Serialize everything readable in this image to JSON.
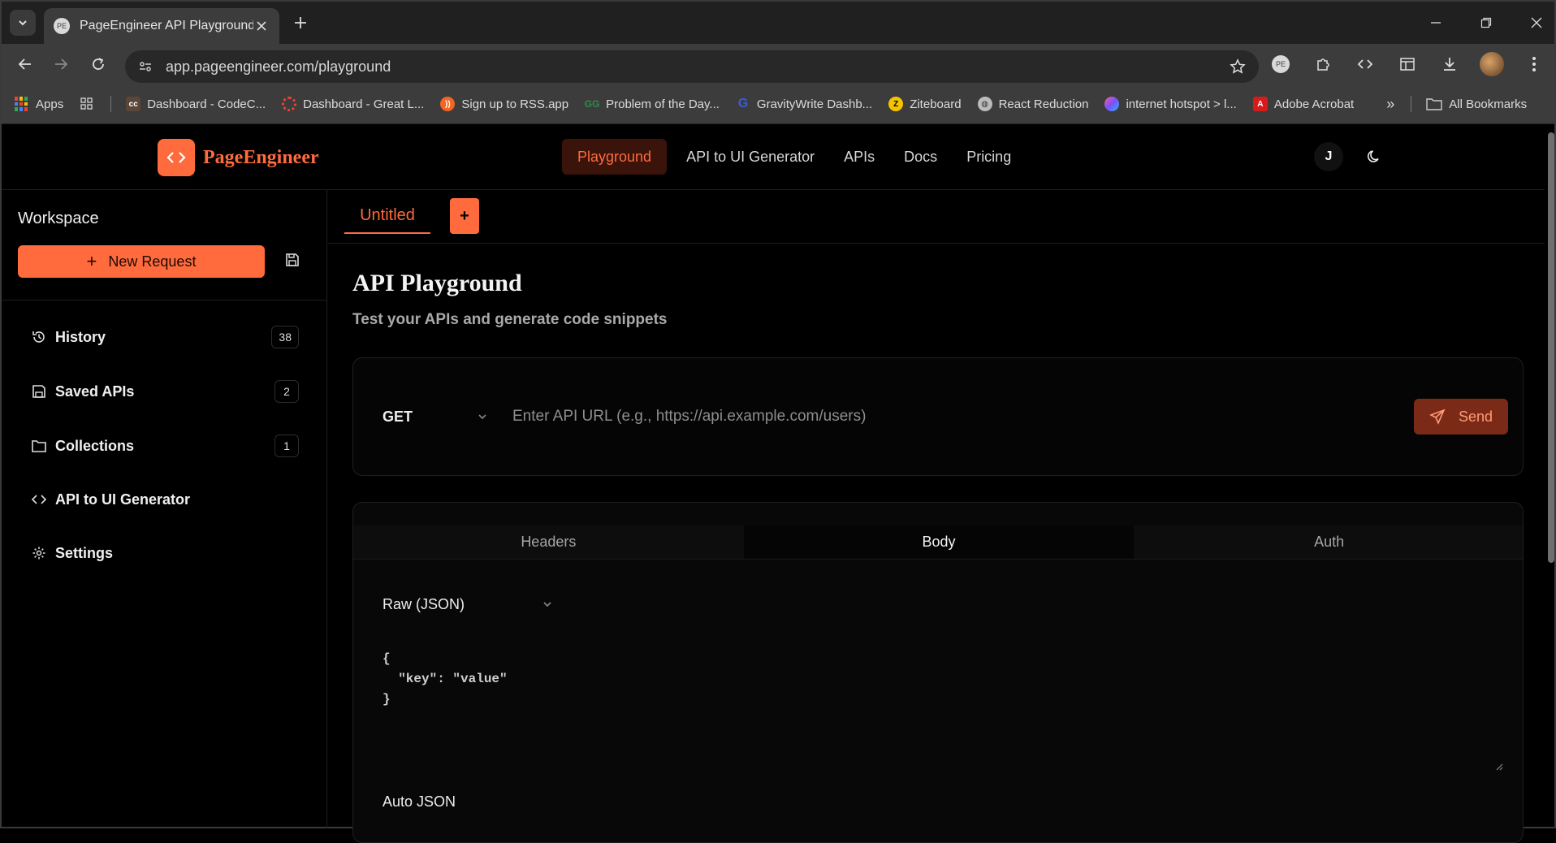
{
  "browser": {
    "tab_title": "PageEngineer API Playground",
    "tab_favicon": "PE",
    "url": "app.pageengineer.com/playground",
    "bookmarks": [
      {
        "label": "Apps",
        "icon": "apps-grid-icon",
        "color": "#4285f4"
      },
      {
        "label": "Dashboard - CodeC...",
        "icon": "codechef-icon",
        "color": "#5b4638"
      },
      {
        "label": "Dashboard - Great L...",
        "icon": "greatlearning-icon",
        "color": "#e94235"
      },
      {
        "label": "Sign up to RSS.app",
        "icon": "rss-icon",
        "color": "#f26522"
      },
      {
        "label": "Problem of the Day...",
        "icon": "gfg-icon",
        "color": "#2f8d46"
      },
      {
        "label": "GravityWrite Dashb...",
        "icon": "gravitywrite-icon",
        "color": "#3b5bdb"
      },
      {
        "label": "Ziteboard",
        "icon": "ziteboard-icon",
        "color": "#f5c400"
      },
      {
        "label": "React Reduction",
        "icon": "globe-icon",
        "color": "#aaaaaa"
      },
      {
        "label": "internet hotspot > l...",
        "icon": "hotspot-icon",
        "color": "#8e6cef"
      },
      {
        "label": "Adobe Acrobat",
        "icon": "acrobat-icon",
        "color": "#d71b1b"
      }
    ],
    "all_bookmarks": "All Bookmarks"
  },
  "app": {
    "brand": "PageEngineer",
    "nav": [
      "Playground",
      "API to UI Generator",
      "APIs",
      "Docs",
      "Pricing"
    ],
    "user_initial": "J",
    "accent": "#ff6b3d"
  },
  "sidebar": {
    "title": "Workspace",
    "new_request": "New Request",
    "items": [
      {
        "label": "History",
        "count": "38",
        "icon": "history-icon"
      },
      {
        "label": "Saved APIs",
        "count": "2",
        "icon": "save-icon"
      },
      {
        "label": "Collections",
        "count": "1",
        "icon": "folder-icon"
      },
      {
        "label": "API to UI Generator",
        "count": null,
        "icon": "code-icon"
      },
      {
        "label": "Settings",
        "count": null,
        "icon": "gear-icon"
      }
    ]
  },
  "main": {
    "tab": "Untitled",
    "add_tab": "+",
    "title": "API Playground",
    "subtitle": "Test your APIs and generate code snippets",
    "method": "GET",
    "url_placeholder": "Enter API URL (e.g., https://api.example.com/users)",
    "send": "Send",
    "body_tabs": [
      "Headers",
      "Body",
      "Auth"
    ],
    "active_body_tab": "Body",
    "body_format": "Raw (JSON)",
    "body_code": "{\n  \"key\": \"value\"\n}",
    "auto_json": "Auto JSON"
  }
}
